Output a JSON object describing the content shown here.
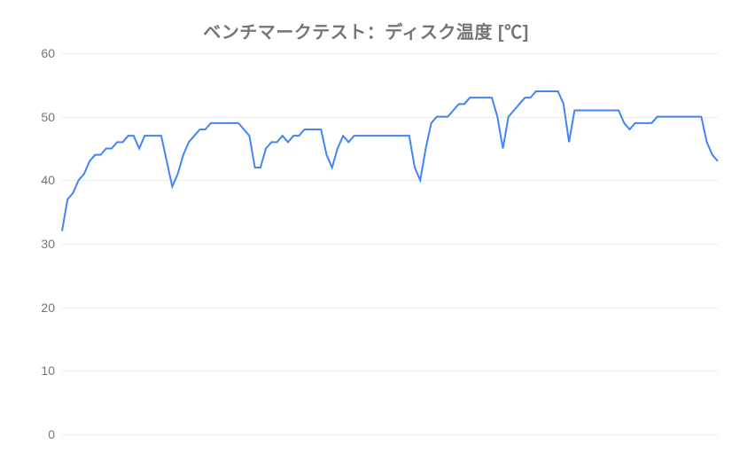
{
  "chart_data": {
    "type": "line",
    "title": "ベンチマークテスト：ディスク温度 [℃]",
    "xlabel": "",
    "ylabel": "",
    "ylim": [
      0,
      60
    ],
    "yticks": [
      0,
      10,
      20,
      30,
      40,
      50,
      60
    ],
    "x": [
      0,
      1,
      2,
      3,
      4,
      5,
      6,
      7,
      8,
      9,
      10,
      11,
      12,
      13,
      14,
      15,
      16,
      17,
      18,
      19,
      20,
      21,
      22,
      23,
      24,
      25,
      26,
      27,
      28,
      29,
      30,
      31,
      32,
      33,
      34,
      35,
      36,
      37,
      38,
      39,
      40,
      41,
      42,
      43,
      44,
      45,
      46,
      47,
      48,
      49,
      50,
      51,
      52,
      53,
      54,
      55,
      56,
      57,
      58,
      59,
      60,
      61,
      62,
      63,
      64,
      65,
      66,
      67,
      68,
      69,
      70,
      71,
      72,
      73,
      74,
      75,
      76,
      77,
      78,
      79,
      80,
      81,
      82,
      83,
      84,
      85,
      86,
      87,
      88,
      89,
      90,
      91,
      92,
      93,
      94,
      95,
      96,
      97,
      98,
      99,
      100,
      101,
      102,
      103,
      104,
      105,
      106,
      107,
      108,
      109,
      110,
      111,
      112,
      113,
      114,
      115,
      116,
      117,
      118,
      119
    ],
    "values": [
      32,
      37,
      38,
      40,
      41,
      43,
      44,
      44,
      45,
      45,
      46,
      46,
      47,
      47,
      45,
      47,
      47,
      47,
      47,
      43,
      39,
      41,
      44,
      46,
      47,
      48,
      48,
      49,
      49,
      49,
      49,
      49,
      49,
      48,
      47,
      42,
      42,
      45,
      46,
      46,
      47,
      46,
      47,
      47,
      48,
      48,
      48,
      48,
      44,
      42,
      45,
      47,
      46,
      47,
      47,
      47,
      47,
      47,
      47,
      47,
      47,
      47,
      47,
      47,
      42,
      40,
      45,
      49,
      50,
      50,
      50,
      51,
      52,
      52,
      53,
      53,
      53,
      53,
      53,
      50,
      45,
      50,
      51,
      52,
      53,
      53,
      54,
      54,
      54,
      54,
      54,
      52,
      46,
      51,
      51,
      51,
      51,
      51,
      51,
      51,
      51,
      51,
      49,
      48,
      49,
      49,
      49,
      49,
      50,
      50,
      50,
      50,
      50,
      50,
      50,
      50,
      50,
      46,
      44,
      43
    ],
    "line_color": "#4285f4"
  }
}
